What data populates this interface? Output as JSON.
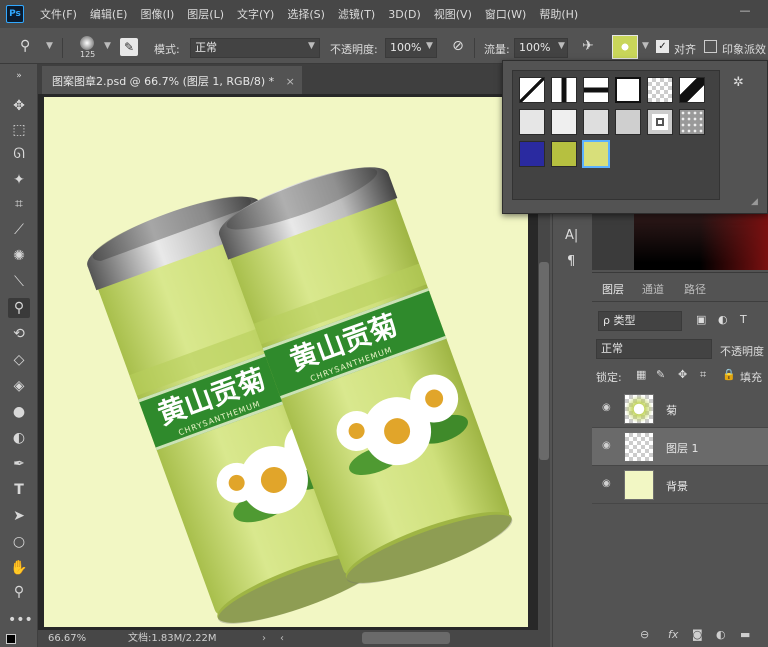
{
  "app": {
    "logo": "Ps"
  },
  "menu": [
    "文件(F)",
    "编辑(E)",
    "图像(I)",
    "图层(L)",
    "文字(Y)",
    "选择(S)",
    "滤镜(T)",
    "3D(D)",
    "视图(V)",
    "窗口(W)",
    "帮助(H)"
  ],
  "window_control": "—",
  "options": {
    "brush_size": "125",
    "mode_label": "模式:",
    "mode_value": "正常",
    "opacity_label": "不透明度:",
    "opacity_value": "100%",
    "flow_label": "流量:",
    "flow_value": "100%",
    "aligned_label": "对齐",
    "impressionist_label": "印象派效"
  },
  "document": {
    "tab_title": "图案图章2.psd @ 66.7% (图层 1, RGB/8) *",
    "close": "×",
    "zoom": "66.67%",
    "doc_size": "文档:1.83M/2.22M"
  },
  "product": {
    "title": "黄山贡菊",
    "subtitle": "CHRYSANTHEMUM"
  },
  "mid_panel": {
    "type_icon": "A|",
    "para_icon": "¶"
  },
  "layers_panel": {
    "tabs": [
      "图层",
      "通道",
      "路径"
    ],
    "filter_label": "ρ 类型",
    "blend_mode": "正常",
    "opacity_label": "不透明度",
    "lock_label": "锁定:",
    "fill_label": "填充",
    "layers": [
      {
        "name": "菊",
        "selected": false
      },
      {
        "name": "图层 1",
        "selected": true
      },
      {
        "name": "背景",
        "selected": false
      }
    ]
  },
  "colors": {
    "canvas_bg": "#f2f7c4",
    "can_green": "#cfe082",
    "band_green": "#2f8a2c",
    "ui_bg": "#535353"
  }
}
